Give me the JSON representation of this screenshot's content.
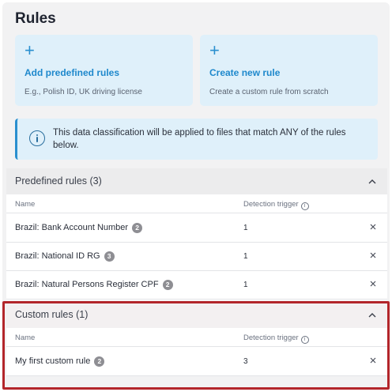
{
  "page": {
    "title": "Rules"
  },
  "cards": [
    {
      "title": "Add predefined rules",
      "subtitle": "E.g., Polish ID, UK driving license"
    },
    {
      "title": "Create new rule",
      "subtitle": "Create a custom rule from scratch"
    }
  ],
  "info": {
    "text": "This data classification will be applied to files that match ANY of the rules below."
  },
  "predefined": {
    "title": "Predefined rules (3)",
    "columns": {
      "name": "Name",
      "trigger": "Detection trigger"
    },
    "rows": [
      {
        "name": "Brazil: Bank Account Number",
        "badge": "2",
        "trigger": "1"
      },
      {
        "name": "Brazil: National ID RG",
        "badge": "3",
        "trigger": "1"
      },
      {
        "name": "Brazil: Natural Persons Register CPF",
        "badge": "2",
        "trigger": "1"
      }
    ]
  },
  "custom": {
    "title": "Custom rules (1)",
    "columns": {
      "name": "Name",
      "trigger": "Detection trigger"
    },
    "rows": [
      {
        "name": "My first custom rule",
        "badge": "2",
        "trigger": "3"
      }
    ]
  },
  "colors": {
    "accent": "#1e88cc",
    "card_bg": "#dff0fa",
    "highlight": "#b3262b",
    "badge": "#8e8e93"
  },
  "icons": {
    "add": "plus-icon",
    "info": "info-icon",
    "collapse": "chevron-up-icon",
    "help": "help-circle-icon",
    "remove": "close-icon"
  }
}
